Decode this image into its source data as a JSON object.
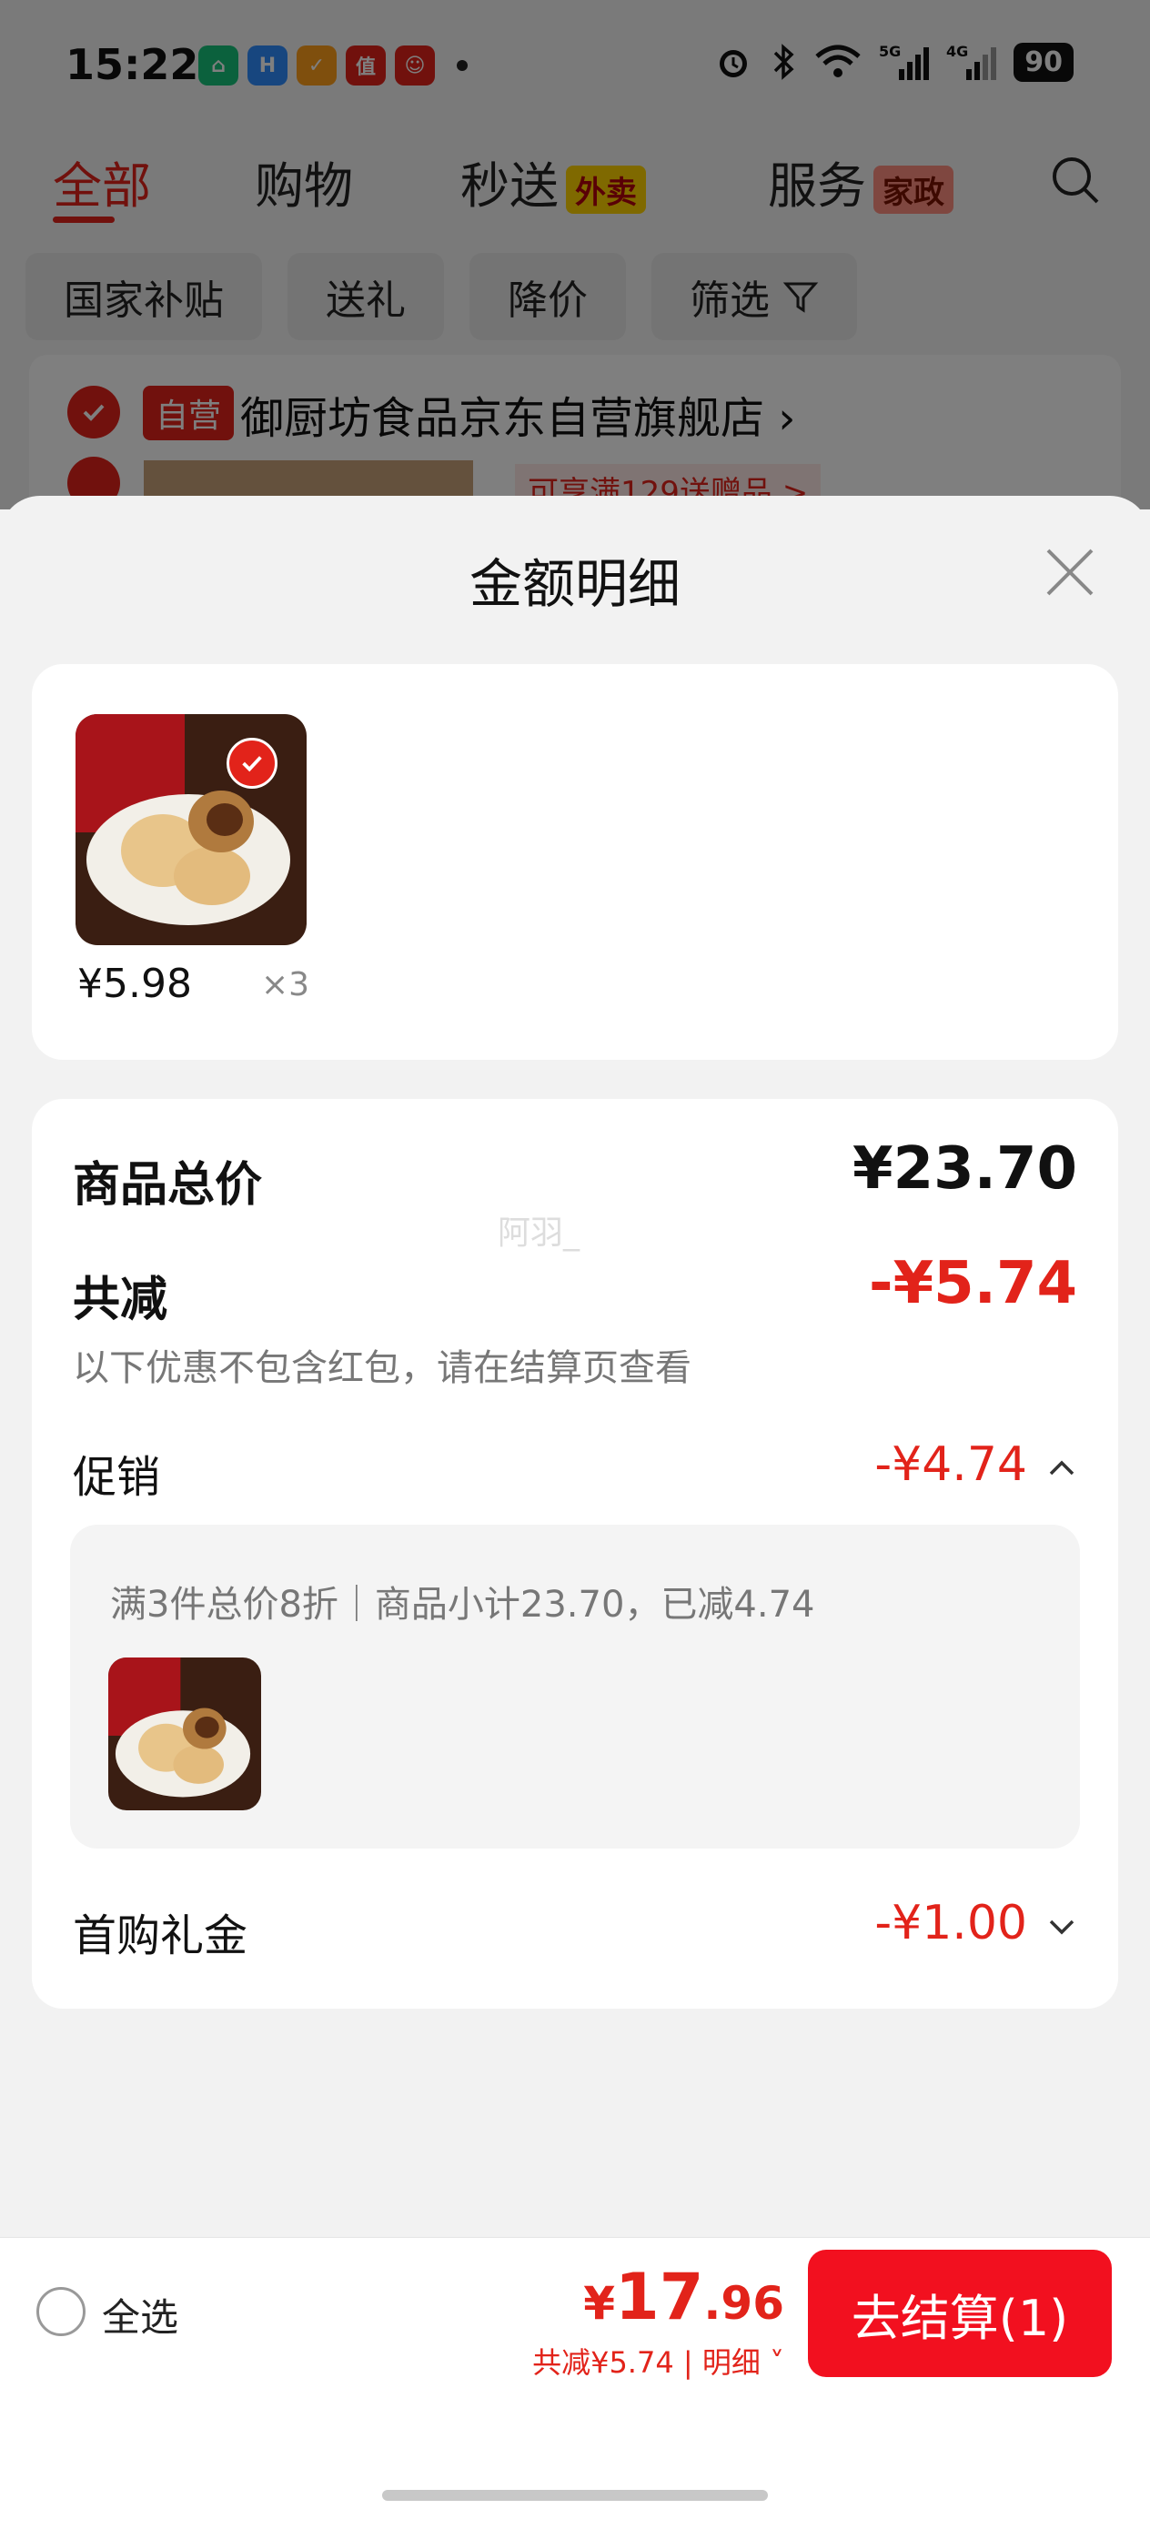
{
  "status_bar": {
    "time": "15:22",
    "battery": "90"
  },
  "top_tabs": [
    {
      "label": "全部"
    },
    {
      "label": "购物"
    },
    {
      "label": "秒送",
      "tag": "外卖"
    },
    {
      "label": "服务",
      "tag": "家政"
    }
  ],
  "filter_chips": [
    "国家补贴",
    "送礼",
    "降价",
    "筛选"
  ],
  "store": {
    "badge": "自营",
    "name": "御厨坊食品京东自营旗舰店",
    "promo": "可享满129送赠品 >"
  },
  "sheet": {
    "title": "金额明细",
    "item": {
      "price": "¥5.98",
      "qty": "×3"
    },
    "watermark": "阿羽_",
    "subtotal": {
      "label": "商品总价",
      "value": "¥23.70"
    },
    "discount": {
      "label": "共减",
      "value": "-¥5.74",
      "note": "以下优惠不包含红包，请在结算页查看"
    },
    "promotion": {
      "label": "促销",
      "value": "-¥4.74",
      "desc": "满3件总价8折｜商品小计23.70，已减4.74"
    },
    "first_gift": {
      "label": "首购礼金",
      "value": "-¥1.00"
    }
  },
  "bottom_bar": {
    "select_all": "全选",
    "total_yen": "¥",
    "total_int": "17",
    "total_dec": ".96",
    "saved": "共减¥5.74 | 明细",
    "checkout": "去结算(1)"
  }
}
